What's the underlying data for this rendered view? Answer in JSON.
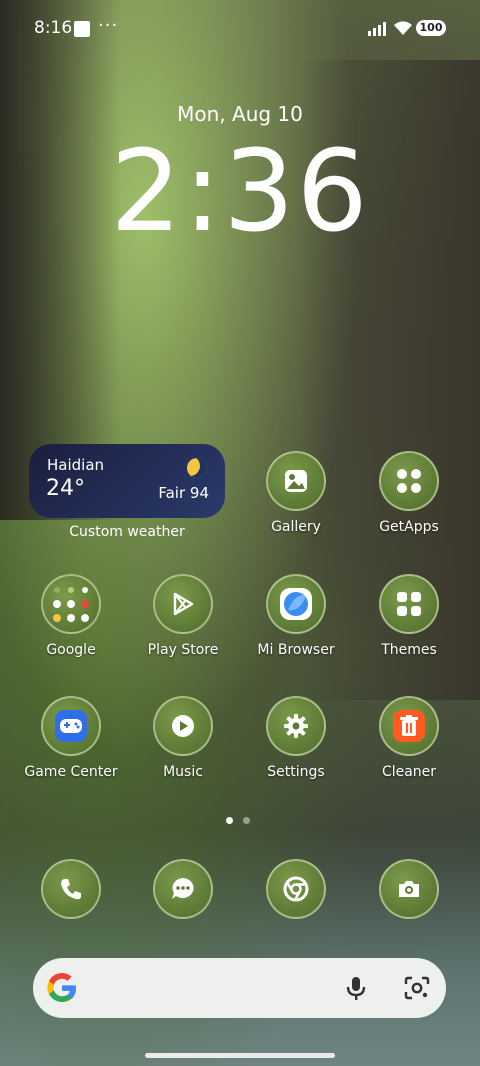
{
  "status_bar": {
    "time": "8:16",
    "overflow": "···",
    "battery": "100"
  },
  "lock_widget": {
    "date": "Mon, Aug 10",
    "clock": "2:36"
  },
  "weather_widget": {
    "city": "Haidian",
    "temperature": "24°",
    "condition": "Fair 94",
    "label": "Custom weather"
  },
  "apps_row1": [
    {
      "label": "Gallery",
      "icon": "gallery-icon"
    },
    {
      "label": "GetApps",
      "icon": "getapps-icon"
    }
  ],
  "apps_row2": [
    {
      "label": "Google",
      "icon": "google-folder-icon"
    },
    {
      "label": "Play Store",
      "icon": "play-store-icon"
    },
    {
      "label": "Mi Browser",
      "icon": "mi-browser-icon"
    },
    {
      "label": "Themes",
      "icon": "themes-icon"
    }
  ],
  "apps_row3": [
    {
      "label": "Game Center",
      "icon": "game-center-icon"
    },
    {
      "label": "Music",
      "icon": "music-icon"
    },
    {
      "label": "Settings",
      "icon": "settings-icon"
    },
    {
      "label": "Cleaner",
      "icon": "cleaner-icon"
    }
  ],
  "dock": [
    {
      "icon": "phone-icon"
    },
    {
      "icon": "messages-icon"
    },
    {
      "icon": "chrome-icon"
    },
    {
      "icon": "camera-icon"
    }
  ],
  "colors": {
    "weather_bg": "#1b1f3e",
    "game_center": "#2f6ee8",
    "cleaner": "#ff5a1f",
    "browser": "#3b8cf0"
  }
}
